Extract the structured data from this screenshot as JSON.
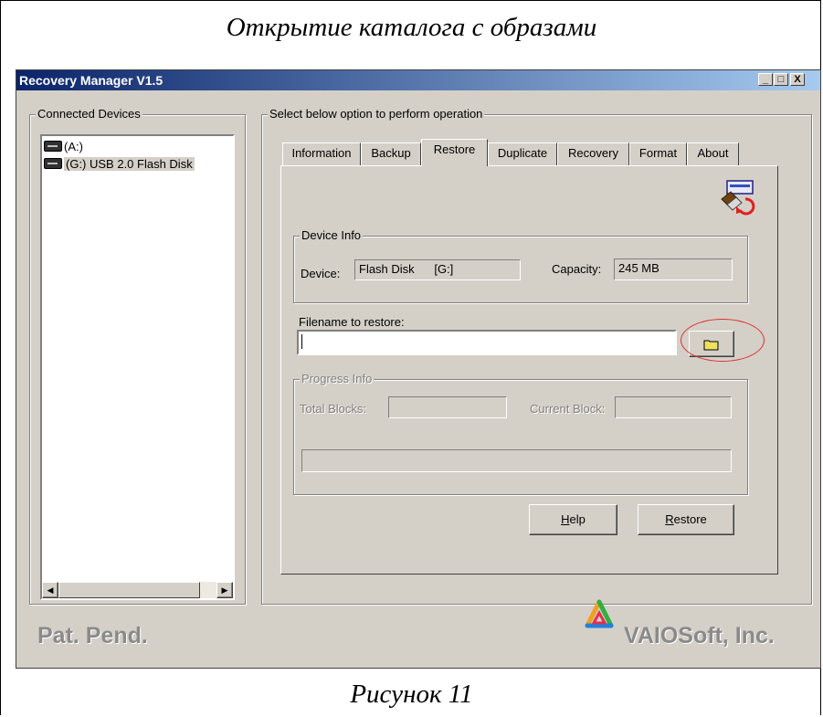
{
  "document": {
    "heading": "Открытие каталога с образами",
    "figure_caption": "Рисунок 11"
  },
  "window": {
    "title": "Recovery Manager V1.5",
    "controls": [
      "_",
      "□",
      "X"
    ]
  },
  "devices": {
    "group_label": "Connected Devices",
    "items": [
      {
        "label": "(A:)",
        "selected": false
      },
      {
        "label": "(G:) USB 2.0  Flash Disk",
        "selected": true
      }
    ]
  },
  "operations": {
    "group_label": "Select below option to perform operation",
    "tabs": [
      {
        "label": "Information",
        "active": false
      },
      {
        "label": "Backup",
        "active": false
      },
      {
        "label": "Restore",
        "active": true
      },
      {
        "label": "Duplicate",
        "active": false
      },
      {
        "label": "Recovery",
        "active": false
      },
      {
        "label": "Format",
        "active": false
      },
      {
        "label": "About",
        "active": false
      }
    ]
  },
  "device_info": {
    "group_label": "Device Info",
    "device_label": "Device:",
    "device_value": "Flash Disk      [G:]",
    "capacity_label": "Capacity:",
    "capacity_value": "245 MB"
  },
  "restore": {
    "filename_label": "Filename to restore:",
    "filename_value": ""
  },
  "progress_info": {
    "group_label": "Progress Info",
    "total_blocks_label": "Total Blocks:",
    "current_block_label": "Current Block:"
  },
  "buttons": {
    "help_mnemonic": "H",
    "help_rest": "elp",
    "restore_mnemonic": "R",
    "restore_rest": "estore"
  },
  "footer": {
    "patent_text": "Pat. Pend.",
    "vendor_text": "VAIOSoft, Inc."
  },
  "colors": {
    "title_gradient_start": "#0a246a",
    "title_gradient_end": "#a6caf0",
    "face": "#d4d0c8",
    "highlight_ellipse": "#e03030"
  }
}
